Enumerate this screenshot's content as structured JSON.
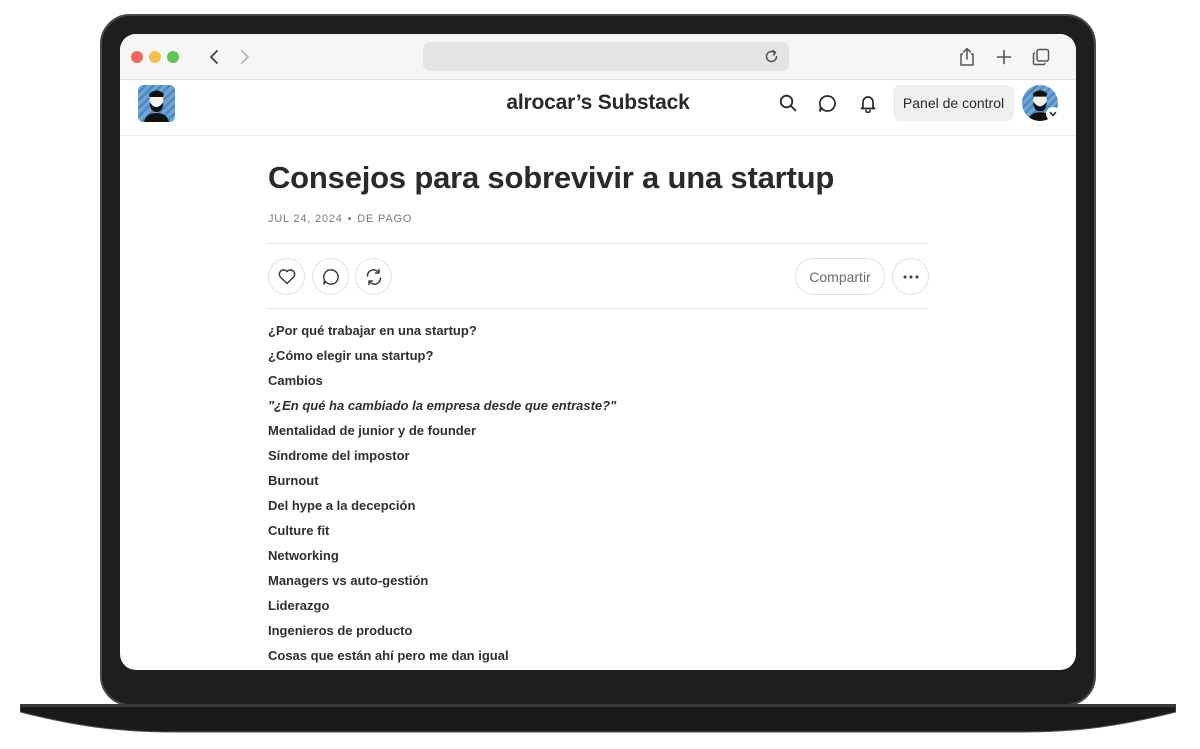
{
  "browser": {
    "icons": [
      "chevron-left-icon",
      "chevron-right-icon",
      "reload-icon",
      "share-icon",
      "plus-icon",
      "tabs-icon"
    ],
    "traffic_colors": {
      "close": "#ed6a5e",
      "minimize": "#f5bf4f",
      "zoom": "#61c554"
    }
  },
  "header": {
    "site_title": "alrocar’s Substack",
    "dashboard_label": "Panel de control",
    "icons": [
      "search-icon",
      "chat-icon",
      "bell-icon"
    ]
  },
  "post": {
    "title": "Consejos para sobrevivir a una startup",
    "date": "JUL 24, 2024",
    "separator": "•",
    "access": "DE PAGO",
    "share_label": "Compartir",
    "action_icons": [
      "heart-icon",
      "comment-icon",
      "restack-icon",
      "more-icon"
    ]
  },
  "toc": [
    {
      "text": "¿Por qué trabajar en una startup?",
      "italic": false
    },
    {
      "text": "¿Cómo elegir una startup?",
      "italic": false
    },
    {
      "text": "Cambios",
      "italic": false
    },
    {
      "text": "\"¿En qué ha cambiado la empresa desde que entraste?\"",
      "italic": true
    },
    {
      "text": "Mentalidad de junior y de founder",
      "italic": false
    },
    {
      "text": "Síndrome del impostor",
      "italic": false
    },
    {
      "text": "Burnout",
      "italic": false
    },
    {
      "text": "Del hype a la decepción",
      "italic": false
    },
    {
      "text": "Culture fit",
      "italic": false
    },
    {
      "text": "Networking",
      "italic": false
    },
    {
      "text": "Managers vs auto-gestión",
      "italic": false
    },
    {
      "text": "Liderazgo",
      "italic": false
    },
    {
      "text": "Ingenieros de producto",
      "italic": false
    },
    {
      "text": "Cosas que están ahí pero me dan igual",
      "italic": false
    }
  ]
}
